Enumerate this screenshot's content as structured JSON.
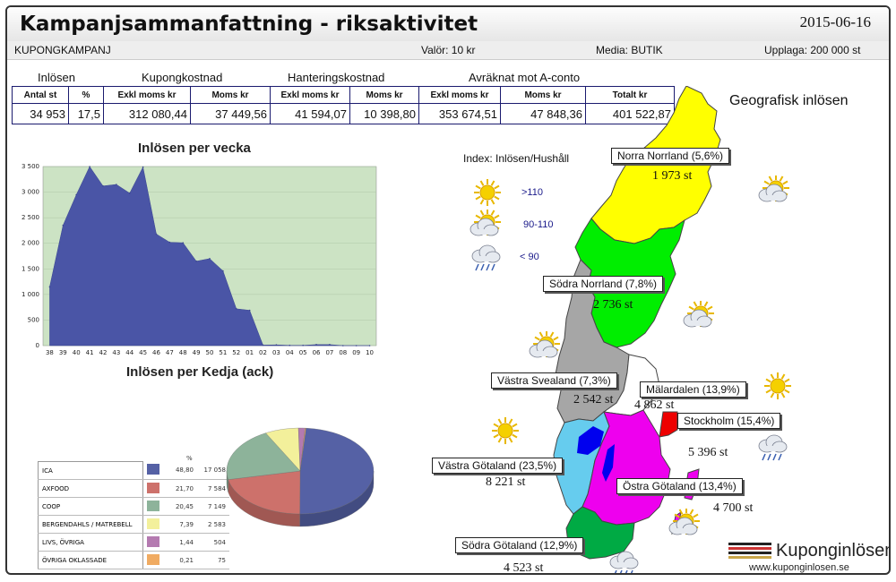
{
  "header": {
    "title": "Kampanjsammanfattning - riksaktivitet",
    "date": "2015-06-16",
    "campaign_type": "KUPONGKAMPANJ",
    "valor": "Valör: 10 kr",
    "media": "Media: BUTIK",
    "upplaga": "Upplaga: 200 000 st"
  },
  "summary": {
    "groups": [
      "Inlösen",
      "Kupongkostnad",
      "Hanteringskostnad",
      "Avräknat mot A-conto"
    ],
    "columns": [
      "Antal st",
      "%",
      "Exkl moms kr",
      "Moms kr",
      "Exkl moms kr",
      "Moms kr",
      "Exkl moms kr",
      "Moms kr",
      "Totalt kr"
    ],
    "values": [
      "34 953",
      "17,5",
      "312 080,44",
      "37 449,56",
      "41 594,07",
      "10 398,80",
      "353 674,51",
      "47 848,36",
      "401 522,87"
    ]
  },
  "weekly_title": "Inlösen per vecka",
  "chain_title": "Inlösen per Kedja (ack)",
  "geo_title": "Geografisk inlösen",
  "index_legend": {
    "title": "Index: Inlösen/Hushåll",
    "items": [
      {
        "label": ">110",
        "icon": "sun-icon"
      },
      {
        "label": "90-110",
        "icon": "sun-cloud-icon"
      },
      {
        "label": "< 90",
        "icon": "rain-cloud-icon"
      }
    ]
  },
  "regions": [
    {
      "name": "Norra Norrland (5,6%)",
      "count": "1 973 st",
      "color": "#ffff00",
      "weather": "sun-cloud-icon"
    },
    {
      "name": "Södra Norrland (7,8%)",
      "count": "2 736 st",
      "color": "#00ee00",
      "weather": "sun-cloud-icon"
    },
    {
      "name": "Västra Svealand (7,3%)",
      "count": "2 542 st",
      "color": "#a6a6a6",
      "weather": "sun-cloud-icon"
    },
    {
      "name": "Mälardalen (13,9%)",
      "count": "4 862 st",
      "color": "#ffffff",
      "weather": "sun-icon"
    },
    {
      "name": "Stockholm (15,4%)",
      "count": "5 396 st",
      "color": "#ee0000",
      "weather": "rain-cloud-icon"
    },
    {
      "name": "Västra Götaland (23,5%)",
      "count": "8 221 st",
      "color": "#66ccee",
      "weather": "sun-icon"
    },
    {
      "name": "Östra Götaland (13,4%)",
      "count": "4 700 st",
      "color": "#ee00ee",
      "weather": "sun-cloud-icon"
    },
    {
      "name": "Södra Götaland (12,9%)",
      "count": "4 523 st",
      "color": "#00aa44",
      "weather": "rain-cloud-icon"
    }
  ],
  "lakes_color": "#0000ee",
  "logo": {
    "name": "Kuponginlösen",
    "url": "www.kuponginlosen.se"
  },
  "chart_data": [
    {
      "type": "area",
      "title": "Inlösen per vecka",
      "xlabel": "",
      "ylabel": "",
      "x": [
        "38",
        "39",
        "40",
        "41",
        "42",
        "43",
        "44",
        "45",
        "46",
        "47",
        "48",
        "49",
        "50",
        "51",
        "52",
        "01",
        "02",
        "03",
        "04",
        "05",
        "06",
        "07",
        "08",
        "09",
        "10"
      ],
      "values": [
        1150,
        2350,
        2950,
        3500,
        3120,
        3150,
        2980,
        3490,
        2180,
        2020,
        2010,
        1650,
        1700,
        1460,
        720,
        690,
        10,
        15,
        5,
        5,
        20,
        20,
        0,
        0,
        0
      ],
      "ylim": [
        0,
        3500
      ],
      "yticks": [
        "0",
        "500",
        "1 000",
        "1 500",
        "2 000",
        "2 500",
        "3 000",
        "3 500"
      ],
      "grid": true,
      "color": "#4a55a6",
      "background": "#cce3c4"
    },
    {
      "type": "pie",
      "title": "Inlösen per Kedja (ack)",
      "header": "%",
      "categories": [
        "ICA",
        "AXFOOD",
        "COOP",
        "BERGENDAHLS / MATREBELL",
        "LIVS, ÖVRIGA",
        "ÖVRIGA OKLASSADE"
      ],
      "percent_labels": [
        "48,80",
        "21,70",
        "20,45",
        "7,39",
        "1,44",
        "0,21"
      ],
      "percent": [
        48.8,
        21.7,
        20.45,
        7.39,
        1.44,
        0.21
      ],
      "count_labels": [
        "17 058",
        "7 584",
        "7 149",
        "2 583",
        "504",
        "75"
      ],
      "colors": [
        "#5561a5",
        "#cd716b",
        "#8db39a",
        "#f3f09b",
        "#b47ab0",
        "#f0ab62"
      ],
      "legend": "left"
    }
  ]
}
